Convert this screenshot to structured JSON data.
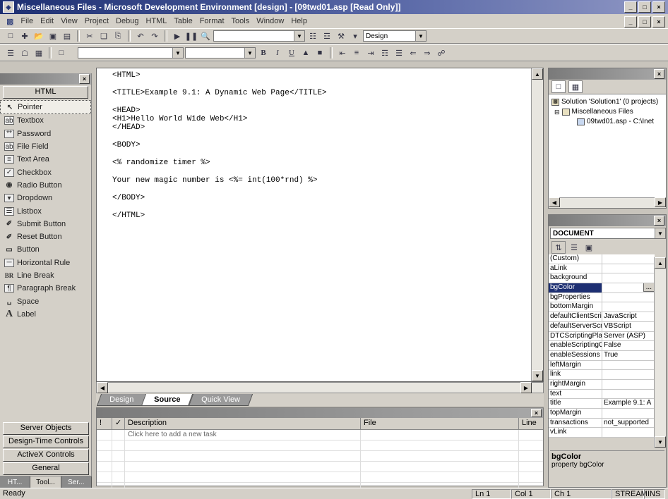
{
  "window": {
    "title": "Miscellaneous Files - Microsoft Development Environment [design] - [09twd01.asp [Read Only]]",
    "buttons": [
      "_",
      "□",
      "×"
    ]
  },
  "menu": [
    "File",
    "Edit",
    "View",
    "Project",
    "Debug",
    "HTML",
    "Table",
    "Format",
    "Tools",
    "Window",
    "Help"
  ],
  "toolbar": {
    "find_icon": "binoculars-icon",
    "view_mode": "Design",
    "bold": "B",
    "italic": "I",
    "underline": "U"
  },
  "toolbox": {
    "title": "",
    "group": "HTML",
    "items": [
      {
        "label": "Pointer",
        "icon": "↖"
      },
      {
        "label": "Textbox",
        "icon": "ab"
      },
      {
        "label": "Password",
        "icon": "**"
      },
      {
        "label": "File Field",
        "icon": "ab"
      },
      {
        "label": "Text Area",
        "icon": "≡"
      },
      {
        "label": "Checkbox",
        "icon": "✓"
      },
      {
        "label": "Radio Button",
        "icon": "◉"
      },
      {
        "label": "Dropdown",
        "icon": "▾"
      },
      {
        "label": "Listbox",
        "icon": "☰"
      },
      {
        "label": "Submit Button",
        "icon": "✐"
      },
      {
        "label": "Reset Button",
        "icon": "✐"
      },
      {
        "label": "Button",
        "icon": "▭"
      },
      {
        "label": "Horizontal Rule",
        "icon": "─"
      },
      {
        "label": "Line Break",
        "icon": "BR"
      },
      {
        "label": "Paragraph Break",
        "icon": "¶"
      },
      {
        "label": "Space",
        "icon": "␣"
      },
      {
        "label": "Label",
        "icon": "A"
      }
    ],
    "bottom_groups": [
      "Server Objects",
      "Design-Time Controls",
      "ActiveX Controls",
      "General"
    ],
    "bottom_tabs": [
      "HT...",
      "Tool...",
      "Ser..."
    ]
  },
  "editor": {
    "lines": [
      "<HTML>",
      "",
      "<TITLE>Example 9.1: A Dynamic Web Page</TITLE>",
      "",
      "<HEAD>",
      "<H1>Hello World Wide Web</H1>",
      "</HEAD>",
      "",
      "<BODY>",
      "",
      "<% randomize timer %>",
      "",
      "Your new magic number is <%= int(100*rnd) %>",
      "",
      "</BODY>",
      "",
      "</HTML>"
    ]
  },
  "view_tabs": [
    "Design",
    "Source",
    "Quick View"
  ],
  "active_view_tab": "Source",
  "task_list": {
    "title": "",
    "columns": [
      "!",
      "✓",
      "Description",
      "File",
      "Line"
    ],
    "placeholder_row": "Click here to add a new task"
  },
  "solution": {
    "title": "",
    "tree": [
      "Solution 'Solution1' (0 projects)",
      "Miscellaneous Files",
      "09twd01.asp - C:\\Inet"
    ]
  },
  "properties": {
    "title": "",
    "object": "DOCUMENT",
    "rows": [
      {
        "name": "(Custom)",
        "value": ""
      },
      {
        "name": "aLink",
        "value": ""
      },
      {
        "name": "background",
        "value": ""
      },
      {
        "name": "bgColor",
        "value": "..."
      },
      {
        "name": "bgProperties",
        "value": ""
      },
      {
        "name": "bottomMargin",
        "value": ""
      },
      {
        "name": "defaultClientScript",
        "value": "JavaScript"
      },
      {
        "name": "defaultServerScript",
        "value": "VBScript"
      },
      {
        "name": "DTCScriptingPlatform",
        "value": "Server (ASP)"
      },
      {
        "name": "enableScriptingObjects",
        "value": "False"
      },
      {
        "name": "enableSessions",
        "value": "True"
      },
      {
        "name": "leftMargin",
        "value": ""
      },
      {
        "name": "link",
        "value": ""
      },
      {
        "name": "rightMargin",
        "value": ""
      },
      {
        "name": "text",
        "value": ""
      },
      {
        "name": "title",
        "value": "Example 9.1: A"
      },
      {
        "name": "topMargin",
        "value": ""
      },
      {
        "name": "transactions",
        "value": "not_supported"
      },
      {
        "name": "vLink",
        "value": ""
      }
    ],
    "desc_title": "bgColor",
    "desc_text": "property bgColor"
  },
  "status": {
    "text": "Ready",
    "ln": "Ln 1",
    "col": "Col 1",
    "ch": "Ch 1",
    "mode1": "STREAM",
    "mode2": "INS"
  }
}
